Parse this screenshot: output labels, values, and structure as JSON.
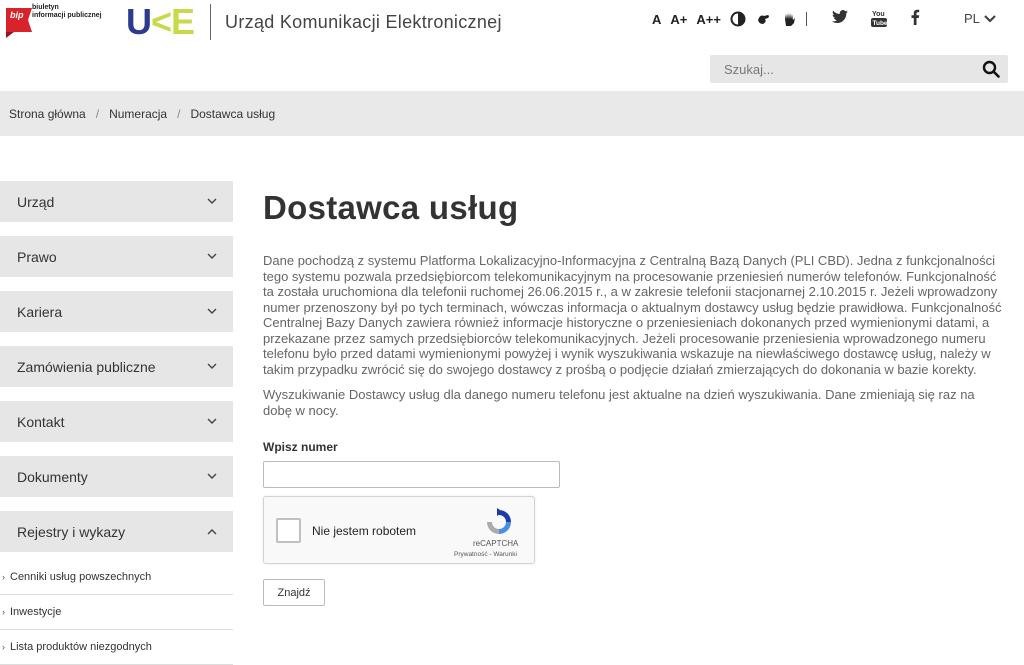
{
  "header": {
    "bip_word": "bip",
    "bip_text_line1": "biuletyn",
    "bip_text_line2": "informacji publicznej",
    "logo_text": "UKE",
    "site_name": "Urząd Komunikacji Elektronicznej",
    "font_sizes": [
      "A",
      "A+",
      "A++"
    ],
    "language": "PL",
    "search_placeholder": "Szukaj..."
  },
  "breadcrumb": [
    "Strona główna",
    "Numeracja",
    "Dostawca usług"
  ],
  "sidebar": {
    "items": [
      {
        "label": "Urząd"
      },
      {
        "label": "Prawo"
      },
      {
        "label": "Kariera"
      },
      {
        "label": "Zamówienia publiczne"
      },
      {
        "label": "Kontakt"
      },
      {
        "label": "Dokumenty"
      },
      {
        "label": "Rejestry i wykazy"
      }
    ],
    "subitems": [
      {
        "label": "Cenniki usług powszechnych"
      },
      {
        "label": "Inwestycje"
      },
      {
        "label": "Lista produktów niezgodnych"
      }
    ]
  },
  "main": {
    "title": "Dostawca usług",
    "paragraph1": "Dane pochodzą z systemu Platforma Lokalizacyjno-Informacyjna z Centralną Bazą Danych (PLI CBD). Jedna z funkcjonalności tego systemu pozwala przedsiębiorcom telekomunikacyjnym na procesowanie przeniesień numerów telefonów. Funkcjonalność ta została uruchomiona dla telefonii ruchomej 26.06.2015 r., a w zakresie telefonii stacjonarnej 2.10.2015 r. Jeżeli wprowadzony numer przenoszony był po tych terminach, wówczas informacja o aktualnym dostawcy usług będzie prawidłowa. Funkcjonalność Centralnej Bazy Danych zawiera również informacje historyczne o przeniesieniach dokonanych przed wymienionymi datami, a przekazane przez samych przedsiębiorców telekomunikacyjnych. Jeżeli procesowanie przeniesienia wprowadzonego numeru telefonu było przed datami wymienionymi powyżej i wynik wyszukiwania wskazuje na niewłaściwego dostawcę usług, należy w takim przypadku zwrócić się do swojego dostawcy z prośbą o podjęcie działań zmierzających do dokonania w bazie korekty.",
    "paragraph2": "Wyszukiwanie Dostawcy usług dla danego numeru telefonu jest aktualne na dzień wyszukiwania. Dane zmieniają się raz na dobę w nocy.",
    "input_label": "Wpisz numer",
    "input_value": "",
    "captcha_text": "Nie jestem robotem",
    "captcha_brand": "reCAPTCHA",
    "captcha_links": "Prywatność - Warunki",
    "submit_label": "Znajdź"
  }
}
